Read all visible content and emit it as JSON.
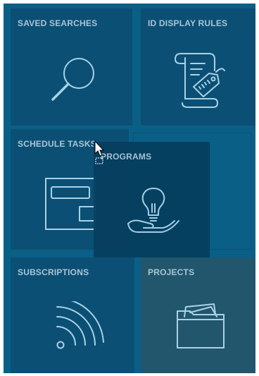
{
  "tiles": {
    "saved_searches": {
      "label": "SAVED SEARCHES",
      "icon": "magnifier-icon"
    },
    "id_display_rules": {
      "label": "ID DISPLAY RULES",
      "icon": "scroll-tag-icon"
    },
    "schedule_tasks": {
      "label": "SCHEDULE TASKS",
      "icon": "window-layout-icon"
    },
    "programs": {
      "label": "PROGRAMS",
      "icon": "hand-lightbulb-icon"
    },
    "subscriptions": {
      "label": "SUBSCRIPTIONS",
      "icon": "rss-feed-icon"
    },
    "projects": {
      "label": "PROJECTS",
      "icon": "folder-documents-icon"
    }
  },
  "colors": {
    "background": "#0a5f86",
    "tile": "#0c4f74",
    "tile_projects": "#22566c",
    "dragged_tile": "#063f60",
    "label": "#a9c6d6",
    "icon_stroke": "#a9d2e6"
  }
}
